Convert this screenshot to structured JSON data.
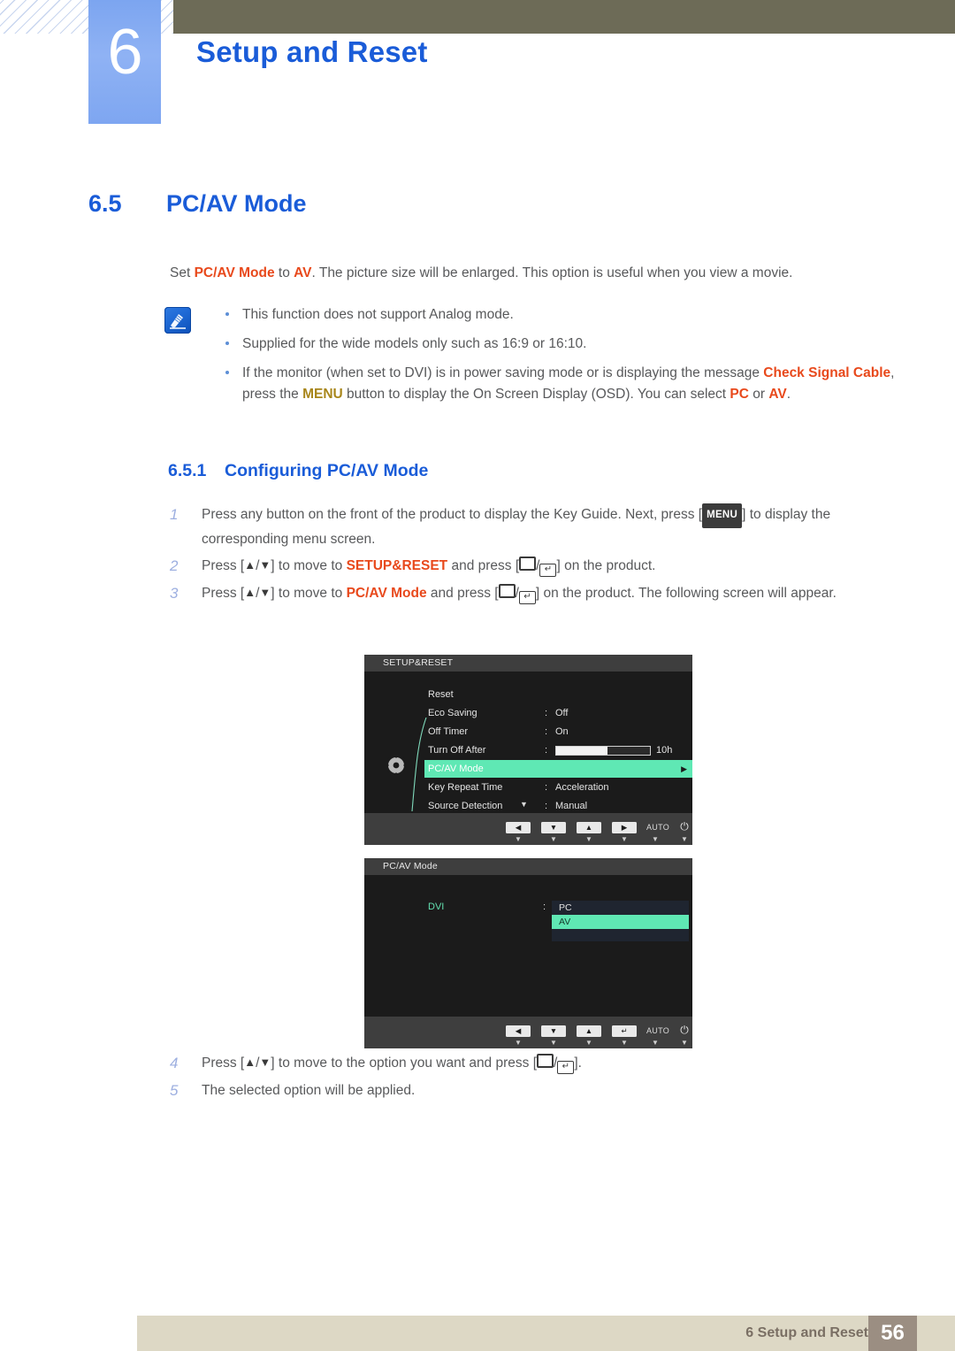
{
  "header": {
    "chapter_number": "6",
    "chapter_title": "Setup and Reset"
  },
  "section": {
    "number": "6.5",
    "title": "PC/AV Mode"
  },
  "lead_paragraph": {
    "p1": "Set ",
    "em1": "PC/AV Mode",
    "p2": " to ",
    "em2": "AV",
    "p3": ". The picture size will be enlarged. This option is useful when you view a movie."
  },
  "note": {
    "icon": "note-pencil-icon",
    "bullets": [
      {
        "text": "This function does not support Analog mode."
      },
      {
        "text": "Supplied for the wide models only such as 16:9 or 16:10."
      },
      {
        "t1": "If the monitor (when set to DVI) is in power saving mode or is displaying the message ",
        "em1": "Check Signal Cable",
        "t2": ", press the ",
        "em2": "MENU",
        "t3": " button to display the On Screen Display (OSD). You can select ",
        "em3": "PC",
        "t4": " or ",
        "em4": "AV",
        "t5": "."
      }
    ]
  },
  "subsection": {
    "number": "6.5.1",
    "title": "Configuring PC/AV Mode"
  },
  "steps_top": [
    {
      "n": "1",
      "t1": "Press any button on the front of the product to display the Key Guide. Next, press [",
      "key": "MENU",
      "t2": "] to display the corresponding menu screen."
    },
    {
      "n": "2",
      "t1": "Press [",
      "up": "▲",
      "slash": "/",
      "down": "▼",
      "t2": "] to move to ",
      "em": "SETUP&RESET",
      "t3": " and press [",
      "t4": "] on the product."
    },
    {
      "n": "3",
      "t1": "Press [",
      "up": "▲",
      "slash": "/",
      "down": "▼",
      "t2": "] to move to ",
      "em": "PC/AV Mode",
      "t3": " and press [",
      "t4": "] on the product. The following screen will appear."
    }
  ],
  "steps_bottom": [
    {
      "n": "4",
      "t1": "Press [",
      "up": "▲",
      "slash": "/",
      "down": "▼",
      "t2": "] to move to the option you want and press [",
      "t3": "]."
    },
    {
      "n": "5",
      "t1": "The selected option will be applied."
    }
  ],
  "osd_setup_reset": {
    "title": "SETUP&RESET",
    "rows": [
      {
        "label": "Reset",
        "colon": "",
        "value": ""
      },
      {
        "label": "Eco Saving",
        "colon": ":",
        "value": "Off"
      },
      {
        "label": "Off Timer",
        "colon": ":",
        "value": "On"
      },
      {
        "label": "Turn Off After",
        "colon": ":",
        "value": "10h",
        "slider_percent": 55
      },
      {
        "label": "PC/AV Mode",
        "colon": "",
        "value": "",
        "selected": true,
        "arrow": "▶"
      },
      {
        "label": "Key Repeat Time",
        "colon": ":",
        "value": "Acceleration"
      },
      {
        "label": "Source Detection",
        "colon": ":",
        "value": "Manual"
      }
    ],
    "scroll_caret": "▼",
    "buttons": [
      {
        "name": "left-arrow-button",
        "glyph": "◀",
        "sub": "▼"
      },
      {
        "name": "down-arrow-button",
        "glyph": "▼",
        "sub": "▼"
      },
      {
        "name": "up-arrow-button",
        "glyph": "▲",
        "sub": "▼"
      },
      {
        "name": "right-arrow-button",
        "glyph": "▶",
        "sub": "▼"
      },
      {
        "name": "auto-button",
        "glyph": "AUTO",
        "sub": "▼"
      },
      {
        "name": "power-button",
        "glyph": "⏻",
        "sub": "▼"
      }
    ]
  },
  "osd_pcav": {
    "title": "PC/AV Mode",
    "source_label": "DVI",
    "colon": ":",
    "options": [
      {
        "label": "PC",
        "selected": false
      },
      {
        "label": "AV",
        "selected": true
      }
    ],
    "buttons": [
      {
        "name": "left-arrow-button",
        "glyph": "◀",
        "sub": "▼"
      },
      {
        "name": "down-arrow-button",
        "glyph": "▼",
        "sub": "▼"
      },
      {
        "name": "up-arrow-button",
        "glyph": "▲",
        "sub": "▼"
      },
      {
        "name": "enter-button",
        "glyph": "↵",
        "sub": "▼"
      },
      {
        "name": "auto-button",
        "glyph": "AUTO",
        "sub": "▼"
      },
      {
        "name": "power-button",
        "glyph": "⏻",
        "sub": "▼"
      }
    ]
  },
  "footer": {
    "label": "6 Setup and Reset",
    "page": "56"
  },
  "colors": {
    "accent_blue": "#1a5cd8",
    "highlight_orange": "#e8491c",
    "menu_gold": "#a8861b",
    "osd_highlight": "#5fe8b4",
    "olive_bar": "#6d6b57",
    "footer_bar": "#ddd8c5",
    "footer_page_box": "#9b8e82"
  }
}
